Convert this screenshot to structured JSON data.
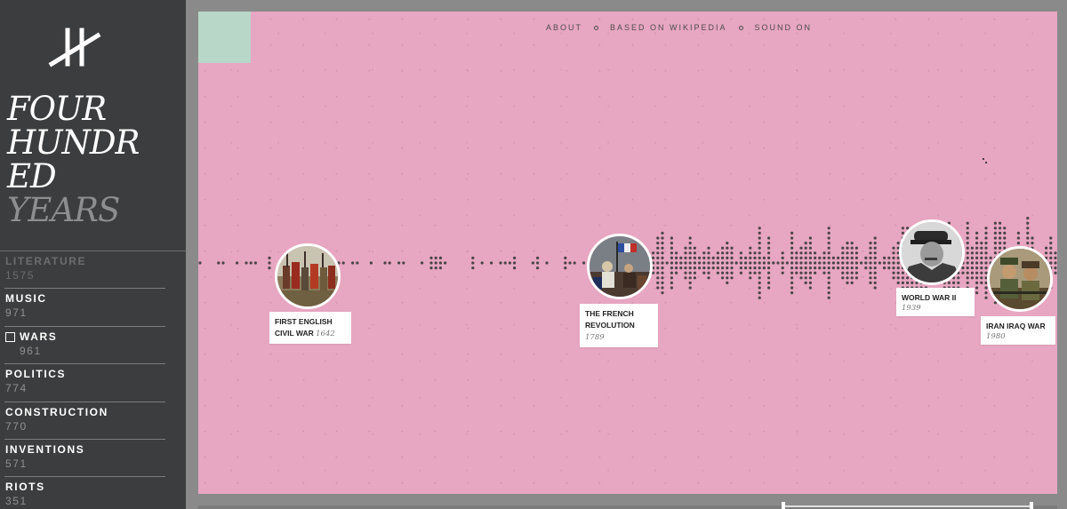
{
  "sidebar": {
    "title_lines": [
      "FOUR",
      "HUNDR",
      "ED",
      "YEARS"
    ],
    "categories": [
      {
        "name": "LITERATURE",
        "count": "1575",
        "state": "faded"
      },
      {
        "name": "MUSIC",
        "count": "971",
        "state": "normal"
      },
      {
        "name": "WARS",
        "count": "961",
        "state": "checked"
      },
      {
        "name": "POLITICS",
        "count": "774",
        "state": "normal"
      },
      {
        "name": "CONSTRUCTION",
        "count": "770",
        "state": "normal"
      },
      {
        "name": "INVENTIONS",
        "count": "571",
        "state": "normal"
      },
      {
        "name": "RIOTS",
        "count": "351",
        "state": "normal"
      }
    ]
  },
  "nav": {
    "about": "ABOUT",
    "based_on": "BASED ON WIKIPEDIA",
    "sound": "SOUND ON"
  },
  "events": [
    {
      "name": "FIRST ENGLISH CIVIL WAR",
      "year": "1642",
      "image": "soldiers-painting"
    },
    {
      "name": "THE FRENCH REVOLUTION",
      "year": "1789",
      "image": "revolution-painting"
    },
    {
      "name": "WORLD WAR II",
      "year": "1939",
      "image": "portrait-photo"
    },
    {
      "name": "IRAN IRAQ WAR",
      "year": "1980",
      "image": "soldiers-photo"
    }
  ],
  "colors": {
    "panel": "#e7a6c1",
    "sidebar": "#3c3d3e",
    "swatch": "#b8d7c8",
    "dots": "#4a4447"
  }
}
